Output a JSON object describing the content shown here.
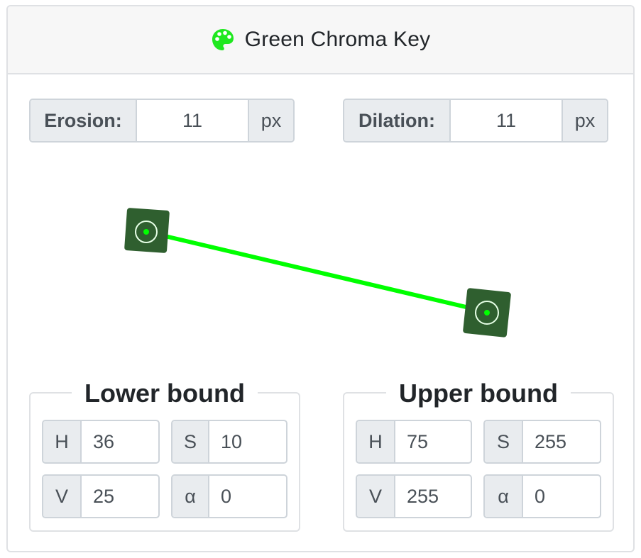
{
  "header": {
    "icon": "palette-icon",
    "icon_color": "#1fe81f",
    "title": "Green Chroma Key"
  },
  "erosion": {
    "label": "Erosion:",
    "value": "11",
    "unit": "px"
  },
  "dilation": {
    "label": "Dilation:",
    "value": "11",
    "unit": "px"
  },
  "gradient_line": {
    "color": "#00ff00",
    "handle_color": "#2f5f2f",
    "handles": [
      {
        "name": "start-handle"
      },
      {
        "name": "end-handle"
      }
    ]
  },
  "lower_bound": {
    "title": "Lower bound",
    "H": {
      "label": "H",
      "value": "36"
    },
    "S": {
      "label": "S",
      "value": "10"
    },
    "V": {
      "label": "V",
      "value": "25"
    },
    "A": {
      "label": "α",
      "value": "0"
    }
  },
  "upper_bound": {
    "title": "Upper bound",
    "H": {
      "label": "H",
      "value": "75"
    },
    "S": {
      "label": "S",
      "value": "255"
    },
    "V": {
      "label": "V",
      "value": "255"
    },
    "A": {
      "label": "α",
      "value": "0"
    }
  }
}
